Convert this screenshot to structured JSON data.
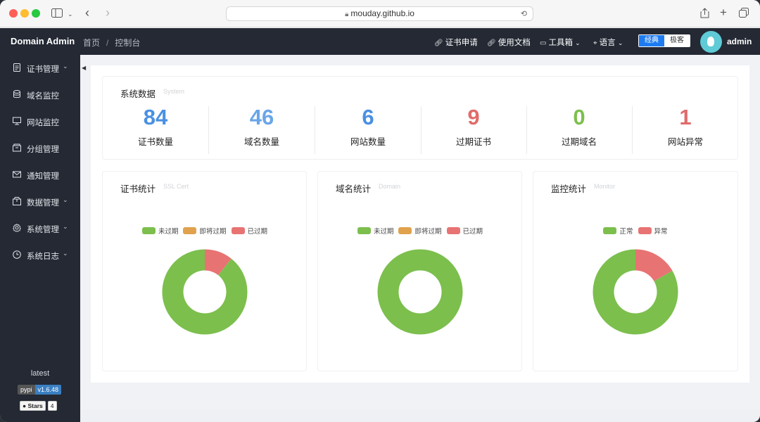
{
  "browser": {
    "url": "mouday.github.io"
  },
  "header": {
    "brand": "Domain Admin",
    "breadcrumb": [
      "首页",
      "控制台"
    ],
    "nav": [
      {
        "label": "证书申请",
        "icon": "link-icon"
      },
      {
        "label": "使用文档",
        "icon": "link-icon"
      },
      {
        "label": "工具箱",
        "icon": "toolbox-icon"
      },
      {
        "label": "语言",
        "icon": "location-icon"
      }
    ],
    "theme_toggle": {
      "active": "经典",
      "inactive": "极客"
    },
    "user": "admin"
  },
  "sidebar": {
    "items": [
      {
        "label": "证书管理",
        "icon": "document-icon",
        "expandable": true
      },
      {
        "label": "域名监控",
        "icon": "database-icon",
        "expandable": false
      },
      {
        "label": "网站监控",
        "icon": "monitor-icon",
        "expandable": false
      },
      {
        "label": "分组管理",
        "icon": "folder-icon",
        "expandable": false
      },
      {
        "label": "通知管理",
        "icon": "mail-icon",
        "expandable": false
      },
      {
        "label": "数据管理",
        "icon": "box-icon",
        "expandable": true
      },
      {
        "label": "系统管理",
        "icon": "gear-icon",
        "expandable": true
      },
      {
        "label": "系统日志",
        "icon": "clock-icon",
        "expandable": true
      }
    ],
    "version_label": "latest",
    "pypi_badge": {
      "left": "pypi",
      "right": "v1.6.48"
    },
    "stars_badge": {
      "left": "Stars",
      "right": "4"
    }
  },
  "system": {
    "title": "系统数据",
    "subtitle": "System",
    "stats": [
      {
        "value": "84",
        "label": "证书数量",
        "color": "#4a90e2"
      },
      {
        "value": "46",
        "label": "域名数量",
        "color": "#6aa6e8"
      },
      {
        "value": "6",
        "label": "网站数量",
        "color": "#4a90e2"
      },
      {
        "value": "9",
        "label": "过期证书",
        "color": "#e06c6c"
      },
      {
        "value": "0",
        "label": "过期域名",
        "color": "#7cbf4d"
      },
      {
        "value": "1",
        "label": "网站异常",
        "color": "#e06c6c"
      }
    ]
  },
  "colors": {
    "green": "#7cbf4d",
    "orange": "#e0a24c",
    "red": "#e87373"
  },
  "panels": [
    {
      "title": "证书统计",
      "subtitle": "SSL Cert",
      "legend": [
        {
          "label": "未过期",
          "color": "#7cbf4d"
        },
        {
          "label": "即将过期",
          "color": "#e0a24c"
        },
        {
          "label": "已过期",
          "color": "#e87373"
        }
      ],
      "values": [
        75,
        0,
        9
      ]
    },
    {
      "title": "域名统计",
      "subtitle": "Domain",
      "legend": [
        {
          "label": "未过期",
          "color": "#7cbf4d"
        },
        {
          "label": "即将过期",
          "color": "#e0a24c"
        },
        {
          "label": "已过期",
          "color": "#e87373"
        }
      ],
      "values": [
        46,
        0,
        0
      ]
    },
    {
      "title": "监控统计",
      "subtitle": "Monitor",
      "legend": [
        {
          "label": "正常",
          "color": "#7cbf4d"
        },
        {
          "label": "异常",
          "color": "#e87373"
        }
      ],
      "values": [
        5,
        1
      ]
    }
  ]
}
